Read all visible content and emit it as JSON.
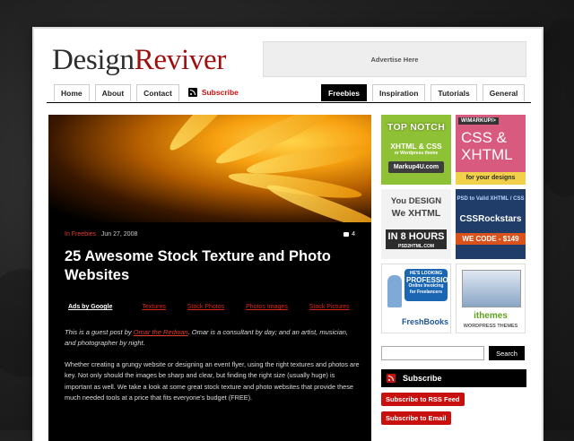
{
  "logo": {
    "part1": "Design",
    "part2": "Reviver"
  },
  "ad_banner": "Advertise Here",
  "nav_left": [
    "Home",
    "About",
    "Contact"
  ],
  "subscribe_link": "Subscribe",
  "nav_right": [
    {
      "label": "Freebies",
      "active": true
    },
    {
      "label": "Inspiration",
      "active": false
    },
    {
      "label": "Tutorials",
      "active": false
    },
    {
      "label": "General",
      "active": false
    }
  ],
  "post": {
    "category": "In Freebies",
    "date": "Jun 27, 2008",
    "comments": "4",
    "title": "25 Awesome Stock Texture and Photo Websites",
    "ads_by": "Ads by Google",
    "ad_links": [
      "Textures",
      "Stock Photos",
      "Photos Images",
      "Stock Pictures"
    ],
    "intro_prefix": "This is a guest post by ",
    "author": "Omar the Redwan",
    "intro_suffix": ". Omar is a consultant by day; and an artist, musician, and photographer by night.",
    "body": "Whether creating a grungy website or designing an event flyer, using the right textures and photos are key. Not only should the images be sharp and clear, but finding the right size (usually huge) is important as well. We take a look at some great stock texture and photo websites that provide these much needed tools at a price that fits everyone's budget (FREE)."
  },
  "sidebar_ads": {
    "markup4u": {
      "line1": "TOP NOTCH",
      "line2": "XHTML & CSS",
      "line3": "or Wordpress theme",
      "button": "Markup4U.com"
    },
    "css_xhtml": {
      "tag": "W\\MARKUP/>",
      "big1": "CSS &",
      "big2": "XHTML",
      "foot": "for your designs"
    },
    "you_design": {
      "line1": "You DESIGN",
      "line2": "We XHTML",
      "line3": "IN 8 HOURS",
      "line4": "PSD2HTML.COM"
    },
    "css_rockstars": {
      "line1": "PSD to Valid XHTML / CSS",
      "line2": "CSSRockstars",
      "line3": "WE CODE - $149"
    },
    "freshbooks": {
      "bubble1": "HE'S LOOKING",
      "bubble2": "PROFESSIONAL",
      "bubble3": "Online Invoicing for Freelancers",
      "brand": "FreshBooks"
    },
    "ithemes": {
      "name": "ithemes",
      "sub": "WORDPRESS THEMES"
    }
  },
  "search": {
    "placeholder": "",
    "button": "Search"
  },
  "subscribe_box": {
    "heading": "Subscribe",
    "rss_button": "Subscribe to RSS Feed",
    "email_button": "Subscribe to Email"
  },
  "colors": {
    "brand_red": "#c8110e",
    "logo_dark": "#2d2d2d",
    "logo_red": "#9e1010"
  }
}
